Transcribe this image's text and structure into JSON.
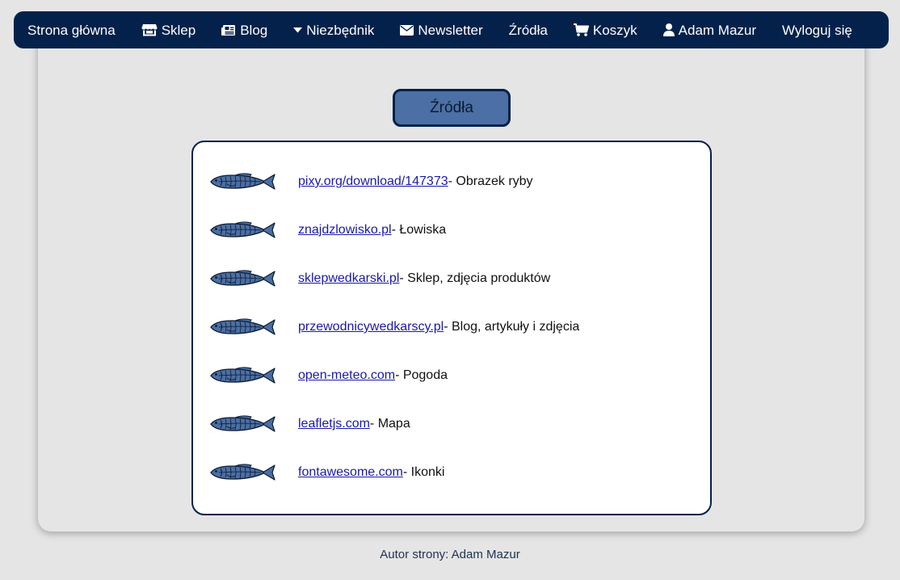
{
  "nav": {
    "items": [
      {
        "label": "Strona główna",
        "icon": ""
      },
      {
        "label": "Sklep",
        "icon": "store-icon"
      },
      {
        "label": "Blog",
        "icon": "newspaper-icon"
      },
      {
        "label": "Niezbędnik",
        "icon": "caret-down-icon"
      },
      {
        "label": "Newsletter",
        "icon": "envelope-icon"
      },
      {
        "label": "Źródła",
        "icon": ""
      },
      {
        "label": "Koszyk",
        "icon": "cart-icon"
      },
      {
        "label": "Adam Mazur",
        "icon": "user-icon"
      },
      {
        "label": "Wyloguj się",
        "icon": ""
      }
    ]
  },
  "page": {
    "title": "Źródła"
  },
  "sources": [
    {
      "link": "pixy.org/download/147373",
      "desc": "- Obrazek ryby",
      "icon": "fish-icon"
    },
    {
      "link": "znajdzlowisko.pl",
      "desc": "- Łowiska",
      "icon": "fish-icon"
    },
    {
      "link": "sklepwedkarski.pl",
      "desc": "- Sklep, zdjęcia produktów",
      "icon": "fish-icon"
    },
    {
      "link": "przewodnicywedkarscy.pl",
      "desc": "- Blog, artykuły i zdjęcia",
      "icon": "fish-icon"
    },
    {
      "link": "open-meteo.com",
      "desc": "- Pogoda",
      "icon": "fish-icon"
    },
    {
      "link": "leafletjs.com",
      "desc": "- Mapa",
      "icon": "fish-icon"
    },
    {
      "link": "fontawesome.com",
      "desc": "- Ikonki",
      "icon": "fish-icon"
    }
  ],
  "footer": {
    "text": "Autor strony: Adam Mazur"
  },
  "colors": {
    "navbar": "#03214a",
    "accent": "#4c6fa5",
    "background": "#e5e5e5",
    "link": "#1a1aa6"
  }
}
